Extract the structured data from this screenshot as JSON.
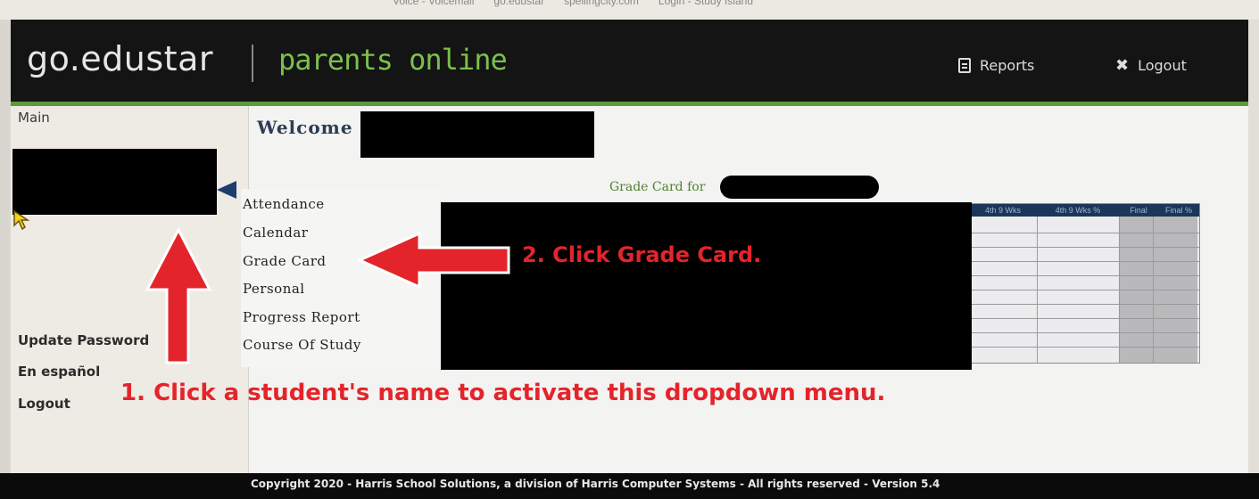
{
  "browser_bookmarks": [
    "Voice - Voicemail",
    "go.edustar",
    "spellingcity.com",
    "Login - Study Island"
  ],
  "header": {
    "logo": "go.edustar",
    "subtitle": "parents online",
    "reports_label": "Reports",
    "logout_label": "Logout"
  },
  "sidebar": {
    "main_label": "Main",
    "update_password": "Update Password",
    "spanish": "En español",
    "logout": "Logout"
  },
  "main": {
    "welcome": "Welcome"
  },
  "dropdown": {
    "items": [
      "Attendance",
      "Calendar",
      "Grade Card",
      "Personal",
      "Progress Report",
      "Course Of Study"
    ]
  },
  "grade_card": {
    "title": "Grade Card for",
    "headers": [
      "4th 9 Wks",
      "4th 9 Wks %",
      "Final",
      "Final %"
    ]
  },
  "annotations": {
    "step1": "1. Click a student's name to activate this dropdown menu.",
    "step2": "2. Click Grade Card."
  },
  "footer": {
    "copyright": "Copyright 2020 - Harris School Solutions, a division of Harris Computer Systems - All rights reserved - Version 5.4"
  },
  "colors": {
    "header_bg": "#141414",
    "brand_green": "#7cc04c",
    "annotation_red": "#e4242b",
    "grade_header": "#1b3658"
  }
}
